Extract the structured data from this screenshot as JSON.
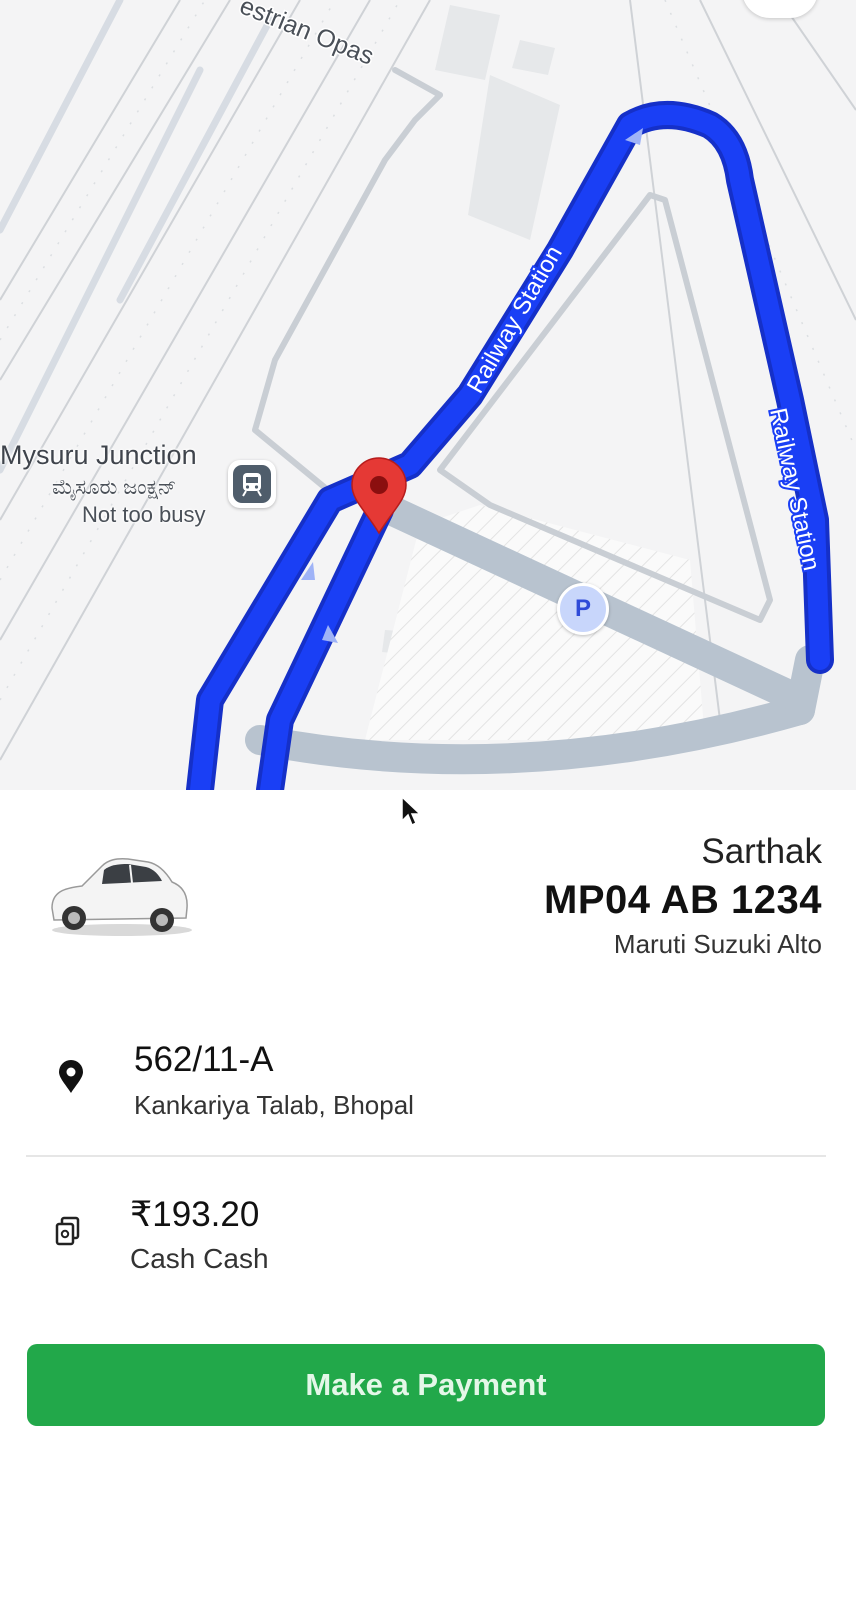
{
  "map": {
    "street_labels": {
      "pedestrian": "estrian Opas",
      "railway_station_1": "Railway Station",
      "railway_station_2": "Railway Station"
    },
    "station": {
      "name": "Mysuru Junction",
      "local_name": "ಮೈಸೂರು ಜಂಕ್ಷನ್",
      "busyness": "Not too busy",
      "icon": "train-station-icon"
    },
    "parking": {
      "label": "P",
      "icon": "parking-icon"
    },
    "pin_icon": "location-pin-icon",
    "route_color": "#1a3ff5",
    "pin_color": "#e53935"
  },
  "driver": {
    "name": "Sarthak",
    "plate": "MP04 AB 1234",
    "car_model": "Maruti Suzuki Alto",
    "car_icon": "car-icon"
  },
  "trip": {
    "address_title": "562/11-A",
    "address_sub": "Kankariya Talab, Bhopal",
    "address_icon": "location-pin-icon"
  },
  "payment": {
    "amount": "₹193.20",
    "method": "Cash Cash",
    "icon": "cash-icon",
    "button_label": "Make a Payment",
    "button_color": "#22a84a"
  }
}
